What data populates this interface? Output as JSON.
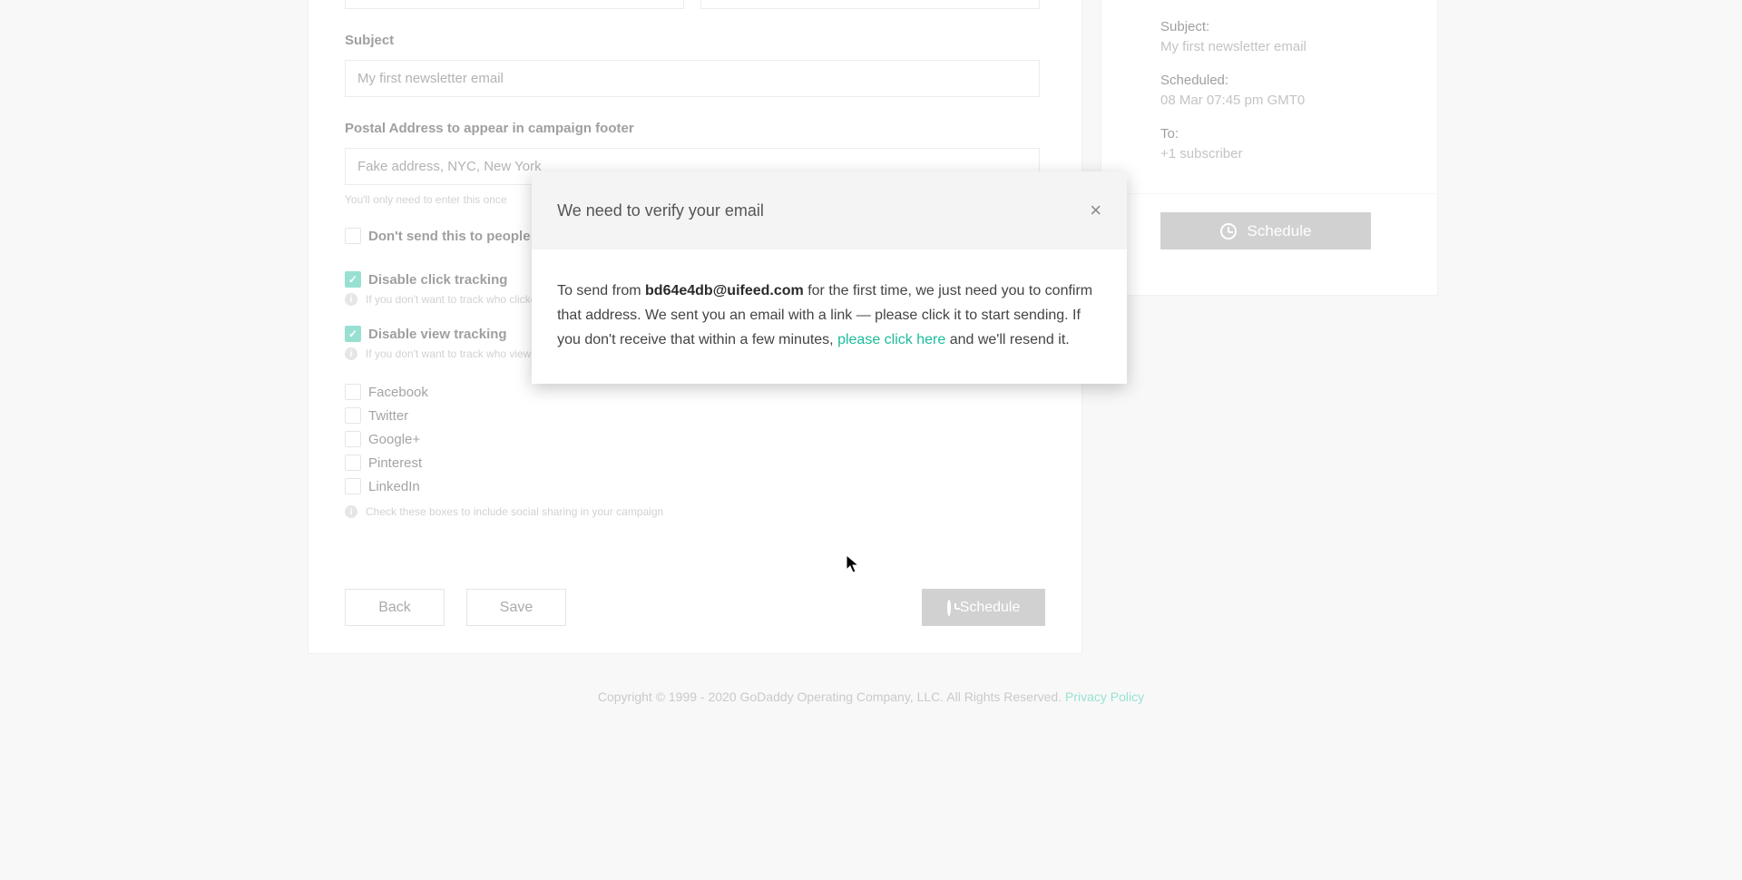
{
  "form": {
    "subject_label": "Subject",
    "subject_value": "My first newsletter email",
    "postal_label": "Postal Address to appear in campaign footer",
    "postal_value": "Fake address, NYC, New York",
    "postal_helper": "You'll only need to enter this once",
    "exclude_label": "Don't send this to people who a",
    "click_track_label": "Disable click tracking",
    "click_track_helper": "If you don't want to track who clicked",
    "view_track_label": "Disable view tracking",
    "view_track_helper": "If you don't want to track who viewed",
    "social": {
      "facebook": "Facebook",
      "twitter": "Twitter",
      "google": "Google+",
      "pinterest": "Pinterest",
      "linkedin": "LinkedIn",
      "helper": "Check these boxes to include social sharing in your campaign"
    },
    "buttons": {
      "back": "Back",
      "save": "Save",
      "schedule": "Schedule"
    }
  },
  "summary": {
    "subject_label": "Subject:",
    "subject_value": "My first newsletter email",
    "scheduled_label": "Scheduled:",
    "scheduled_value": "08 Mar 07:45 pm GMT0",
    "to_label": "To:",
    "to_value": "+1 subscriber",
    "schedule_btn": "Schedule"
  },
  "footer": {
    "text": "Copyright © 1999 - 2020 GoDaddy Operating Company, LLC. All Rights Reserved. ",
    "link": "Privacy Policy"
  },
  "modal": {
    "title": "We need to verify your email",
    "body_pre": "To send from ",
    "email": "bd64e4db@uifeed.com",
    "body_mid": " for the first time, we just need you to confirm that address. We sent you an email with a link — please click it to start sending. If you don't receive that within a few minutes, ",
    "link": "please click here",
    "body_post": " and we'll resend it."
  }
}
